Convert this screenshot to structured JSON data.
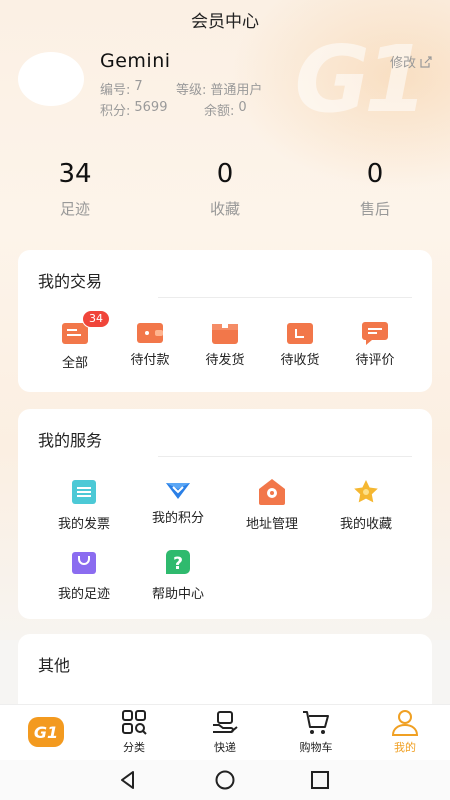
{
  "header": {
    "title": "会员中心"
  },
  "background": {
    "watermark": "G1"
  },
  "user": {
    "name": "Gemini",
    "id_label": "编号:",
    "id_value": "7",
    "level_label": "等级:",
    "level_value": "普通用户",
    "points_label": "积分:",
    "points_value": "5699",
    "balance_label": "余额:",
    "balance_value": "0",
    "edit_label": "修改"
  },
  "stats": [
    {
      "value": "34",
      "label": "足迹"
    },
    {
      "value": "0",
      "label": "收藏"
    },
    {
      "value": "0",
      "label": "售后"
    }
  ],
  "trade": {
    "title": "我的交易",
    "items": [
      {
        "label": "全部",
        "badge": "34",
        "icon": "order-list-icon"
      },
      {
        "label": "待付款",
        "icon": "wallet-icon"
      },
      {
        "label": "待发货",
        "icon": "box-icon"
      },
      {
        "label": "待收货",
        "icon": "receive-icon"
      },
      {
        "label": "待评价",
        "icon": "comment-icon"
      }
    ]
  },
  "services": {
    "title": "我的服务",
    "items": [
      {
        "label": "我的发票",
        "icon": "invoice-icon"
      },
      {
        "label": "我的积分",
        "icon": "points-icon"
      },
      {
        "label": "地址管理",
        "icon": "address-icon"
      },
      {
        "label": "我的收藏",
        "icon": "star-icon"
      },
      {
        "label": "我的足迹",
        "icon": "footprint-bag-icon"
      },
      {
        "label": "帮助中心",
        "icon": "help-icon"
      }
    ]
  },
  "other": {
    "title": "其他"
  },
  "tabbar": {
    "logo": "G1",
    "items": [
      {
        "label": "分类",
        "icon": "category-icon"
      },
      {
        "label": "快递",
        "icon": "delivery-icon"
      },
      {
        "label": "购物车",
        "icon": "cart-icon"
      },
      {
        "label": "我的",
        "icon": "user-icon",
        "active": true
      }
    ]
  },
  "colors": {
    "accent": "#f0a023",
    "badge": "#f0453a",
    "trade_icon": "#f2774a"
  }
}
